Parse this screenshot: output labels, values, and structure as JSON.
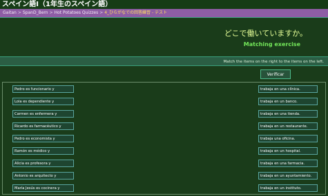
{
  "page_title": "スペイン語I（1年生のスペイン語）",
  "breadcrumb": {
    "items": [
      "Gaitan",
      "SpanD_Bern",
      "Hot Potatoes Quizzes"
    ],
    "current": "4_ひらがなでの回答練習 - テスト"
  },
  "exercise": {
    "japanese_question": "どこで働いていますか。",
    "title": "Matching exercise",
    "instructions": "Match the items on the right to the items on the left.",
    "verify_label": "Verificar"
  },
  "left_items": [
    "Pedro es funcionario y",
    "Lola es dependiente y",
    "Carmen es enfermera y",
    "Ricardo es farmacéutico y",
    "Pedro es economista y",
    "Ramón es médico y",
    "Alicia es profesora y",
    "Antonio es arquitecto y",
    "María Jesús es cocinera y"
  ],
  "right_items": [
    "trabaja en una clínica.",
    "trabaja en un banco.",
    "trabaja en una tienda.",
    "trabaja en un restaurante.",
    "trabaja una oficina.",
    "trabaja en un hospital.",
    "trabaja en una farmacia.",
    "trabaja en un ayuntamiento.",
    "trabaja en un instituto."
  ],
  "colors": {
    "background": "#1a3c1a",
    "breadcrumb_bar": "#8e5da5",
    "title_green": "#74e85a",
    "question_yellow": "#e6ff98"
  }
}
